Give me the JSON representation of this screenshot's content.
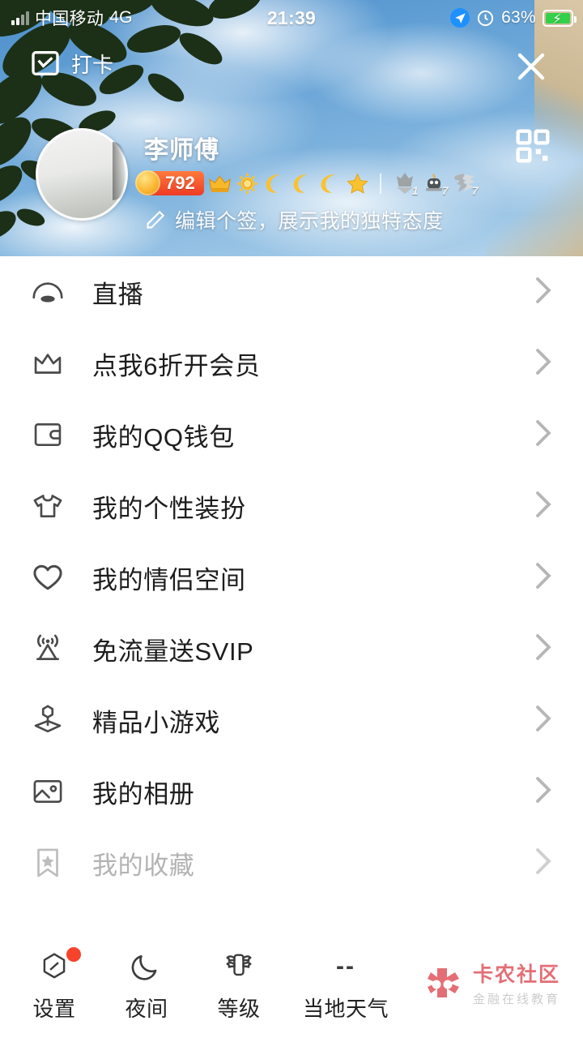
{
  "status_bar": {
    "carrier": "中国移动",
    "network": "4G",
    "time": "21:39",
    "battery_percent": "63%",
    "battery_charging": true,
    "icons": [
      "signal-bars-icon",
      "navigation-arrow-icon",
      "alarm-icon",
      "battery-icon"
    ]
  },
  "header": {
    "checkin_label": "打卡",
    "checkin_icon": "calendar-check-icon",
    "close_icon": "close-icon",
    "qr_icon": "qr-code-icon",
    "avatar_icon": "avatar",
    "nickname": "李师傅",
    "coin_count": "792",
    "level_badges": [
      "crown-icon",
      "sun-icon",
      "moon-icon",
      "moon-icon",
      "moon-icon",
      "star-icon"
    ],
    "gray_badges": [
      {
        "icon": "gray-crown-badge-icon",
        "count": "1"
      },
      {
        "icon": "gray-sprout-badge-icon",
        "count": "7"
      },
      {
        "icon": "gray-lightning-badge-icon",
        "count": "7"
      }
    ],
    "signature_icon": "pencil-edit-icon",
    "signature_text": "编辑个签，展示我的独特态度"
  },
  "menu": {
    "items": [
      {
        "icon": "live-broadcast-icon",
        "label": "直播",
        "faded": false
      },
      {
        "icon": "crown-vip-icon",
        "label": "点我6折开会员",
        "faded": false
      },
      {
        "icon": "wallet-icon",
        "label": "我的QQ钱包",
        "faded": false
      },
      {
        "icon": "tshirt-icon",
        "label": "我的个性装扮",
        "faded": false
      },
      {
        "icon": "heart-icon",
        "label": "我的情侣空间",
        "faded": false
      },
      {
        "icon": "signal-tower-icon",
        "label": "免流量送SVIP",
        "faded": false
      },
      {
        "icon": "game-controller-icon",
        "label": "精品小游戏",
        "faded": false
      },
      {
        "icon": "photo-album-icon",
        "label": "我的相册",
        "faded": false
      },
      {
        "icon": "bookmark-star-icon",
        "label": "我的收藏",
        "faded": true
      }
    ],
    "chevron_icon": "chevron-right-icon"
  },
  "bottom_bar": {
    "items": [
      {
        "icon": "gear-settings-icon",
        "label": "设置",
        "badge": true
      },
      {
        "icon": "moon-night-icon",
        "label": "夜间",
        "badge": false
      },
      {
        "icon": "level-wings-icon",
        "label": "等级",
        "badge": false
      },
      {
        "icon": "weather-icon",
        "label": "当地天气",
        "badge": false,
        "value": "--"
      }
    ]
  },
  "watermark": {
    "title": "卡农社区",
    "subtitle": "金融在线教育"
  },
  "colors": {
    "accent_red": "#ef3b25",
    "badge_red": "#f6432b",
    "sky_blue": "#5f9ed4",
    "watermark_pink": "#e2626a"
  }
}
